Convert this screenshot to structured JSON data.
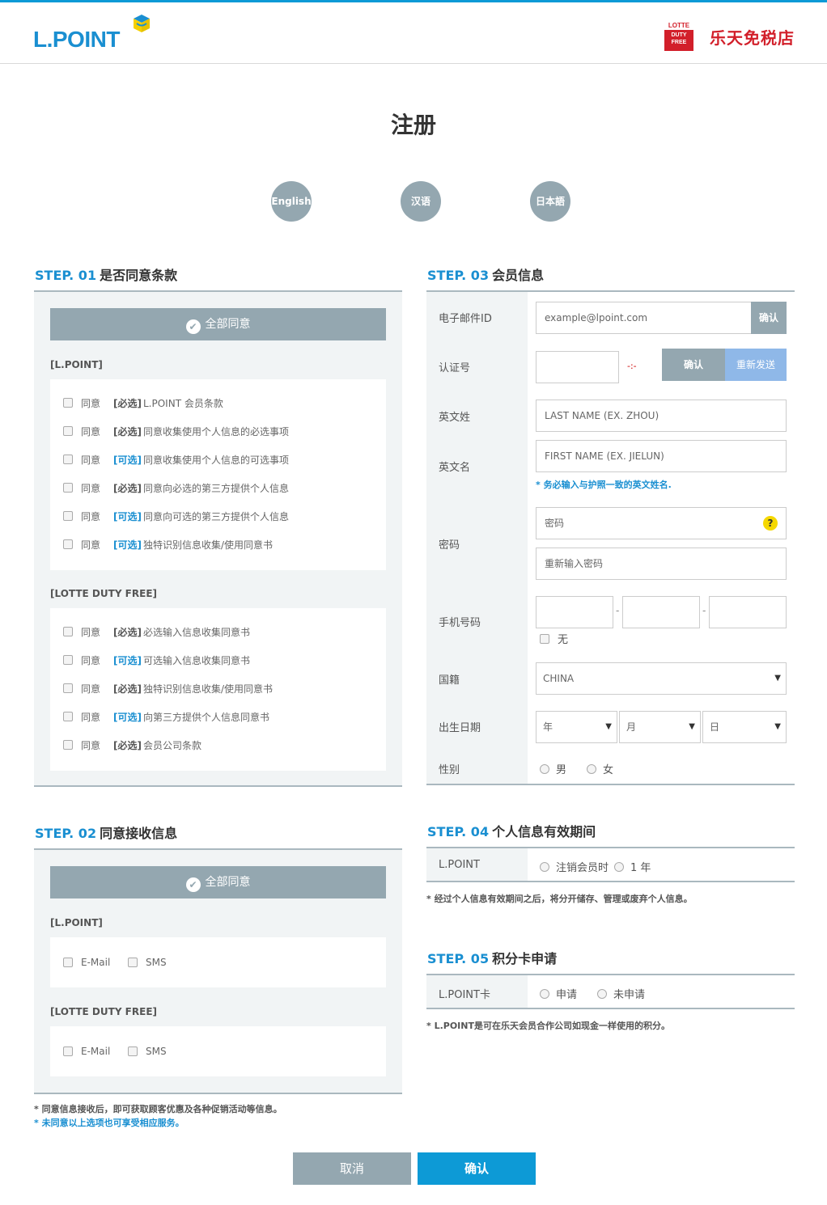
{
  "header": {
    "logo_text": "L.POINT",
    "partner_badge_top": "LOTTE",
    "partner_badge_line1": "DUTY",
    "partner_badge_line2": "FREE",
    "partner_name": "乐天免税店"
  },
  "page_title": "注册",
  "languages": [
    "English",
    "汉语",
    "日本語"
  ],
  "step1": {
    "num": "STEP. 01",
    "title": "是否同意条款",
    "agree_all": "全部同意",
    "group1_label": "[L.POINT]",
    "group1_items": [
      {
        "agree": "同意",
        "tag": "[必选]",
        "type": "req",
        "text": "L.POINT 会员条款"
      },
      {
        "agree": "同意",
        "tag": "[必选]",
        "type": "req",
        "text": "同意收集使用个人信息的必选事项"
      },
      {
        "agree": "同意",
        "tag": "[可选]",
        "type": "opt",
        "text": "同意收集使用个人信息的可选事项"
      },
      {
        "agree": "同意",
        "tag": "[必选]",
        "type": "req",
        "text": "同意向必选的第三方提供个人信息"
      },
      {
        "agree": "同意",
        "tag": "[可选]",
        "type": "opt",
        "text": "同意向可选的第三方提供个人信息"
      },
      {
        "agree": "同意",
        "tag": "[可选]",
        "type": "opt",
        "text": "独特识别信息收集/使用同意书"
      }
    ],
    "group2_label": "[LOTTE DUTY FREE]",
    "group2_items": [
      {
        "agree": "同意",
        "tag": "[必选]",
        "type": "req",
        "text": "必选输入信息收集同意书"
      },
      {
        "agree": "同意",
        "tag": "[可选]",
        "type": "opt",
        "text": "可选输入信息收集同意书"
      },
      {
        "agree": "同意",
        "tag": "[必选]",
        "type": "req",
        "text": "独特识别信息收集/使用同意书"
      },
      {
        "agree": "同意",
        "tag": "[可选]",
        "type": "opt",
        "text": "向第三方提供个人信息同意书"
      },
      {
        "agree": "同意",
        "tag": "[必选]",
        "type": "req",
        "text": "会员公司条款"
      }
    ]
  },
  "step2": {
    "num": "STEP. 02",
    "title": "同意接收信息",
    "agree_all": "全部同意",
    "group1_label": "[L.POINT]",
    "group2_label": "[LOTTE DUTY FREE]",
    "email": "E-Mail",
    "sms": "SMS",
    "note1": "* 同意信息接收后，即可获取顾客优惠及各种促销活动等信息。",
    "note2": "* 未同意以上选项也可享受相应服务。"
  },
  "step3": {
    "num": "STEP. 03",
    "title": "会员信息",
    "email_label": "电子邮件ID",
    "email_placeholder": "example@lpoint.com",
    "email_confirm": "确认",
    "code_label": "认证号",
    "timer": "-:-",
    "code_confirm": "确认",
    "resend": "重新发送",
    "last_name_label": "英文姓",
    "last_name_placeholder": "LAST NAME (EX. ZHOU)",
    "first_name_label": "英文名",
    "first_name_placeholder": "FIRST NAME (EX. JIELUN)",
    "name_note": "* 务必输入与护照一致的英文姓名.",
    "password_label": "密码",
    "password_placeholder": "密码",
    "password_confirm_placeholder": "重新输入密码",
    "help_mark": "?",
    "phone_label": "手机号码",
    "phone_sep": "-",
    "no_phone": "无",
    "nationality_label": "国籍",
    "nationality_value": "CHINA",
    "birth_label": "出生日期",
    "year": "年",
    "month": "月",
    "day": "日",
    "gender_label": "性别",
    "male": "男",
    "female": "女",
    "select_arrow": "▼"
  },
  "step4": {
    "num": "STEP. 04",
    "title": "个人信息有效期间",
    "row_label": "L.POINT",
    "option1": "注销会员时",
    "option2": "1 年",
    "note": "* 经过个人信息有效期间之后，将分开储存、管理或废弃个人信息。"
  },
  "step5": {
    "num": "STEP. 05",
    "title": "积分卡申请",
    "row_label": "L.POINT卡",
    "option1": "申请",
    "option2": "未申请",
    "note": "* L.POINT是可在乐天会员合作公司如现金一样使用的积分。"
  },
  "footer": {
    "cancel": "取消",
    "confirm": "确认"
  },
  "colors": {
    "brand_blue": "#0d9ad6",
    "panel_gray": "#94a7b0",
    "lotte_red": "#d21f2a"
  }
}
